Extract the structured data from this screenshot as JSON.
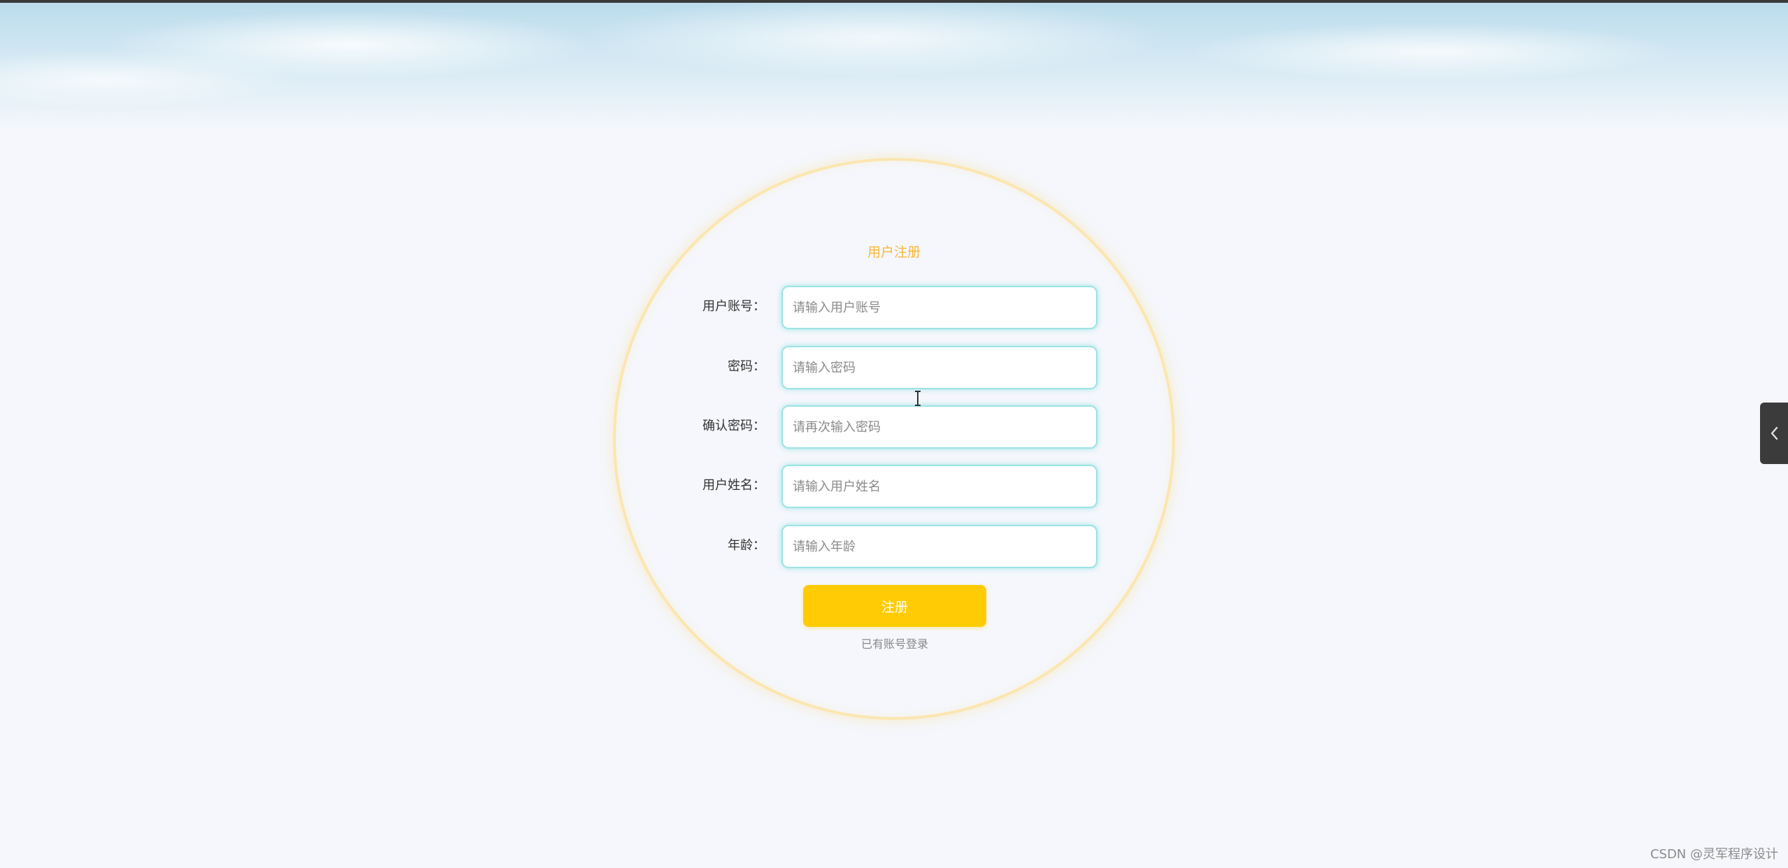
{
  "form": {
    "title": "用户注册",
    "fields": [
      {
        "label": "用户账号：",
        "placeholder": "请输入用户账号",
        "value": ""
      },
      {
        "label": "密码：",
        "placeholder": "请输入密码",
        "value": ""
      },
      {
        "label": "确认密码：",
        "placeholder": "请再次输入密码",
        "value": ""
      },
      {
        "label": "用户姓名：",
        "placeholder": "请输入用户姓名",
        "value": ""
      },
      {
        "label": "年龄：",
        "placeholder": "请输入年龄",
        "value": ""
      }
    ],
    "submit_label": "注册",
    "login_link": "已有账号登录"
  },
  "side_tab": {
    "icon": "chevron-left-icon"
  },
  "watermark": "CSDN @灵军程序设计",
  "colors": {
    "accent": "#ffcb05",
    "title": "#f5b93a",
    "field_border": "#9de3e3",
    "ring": "#fbe6b0"
  }
}
